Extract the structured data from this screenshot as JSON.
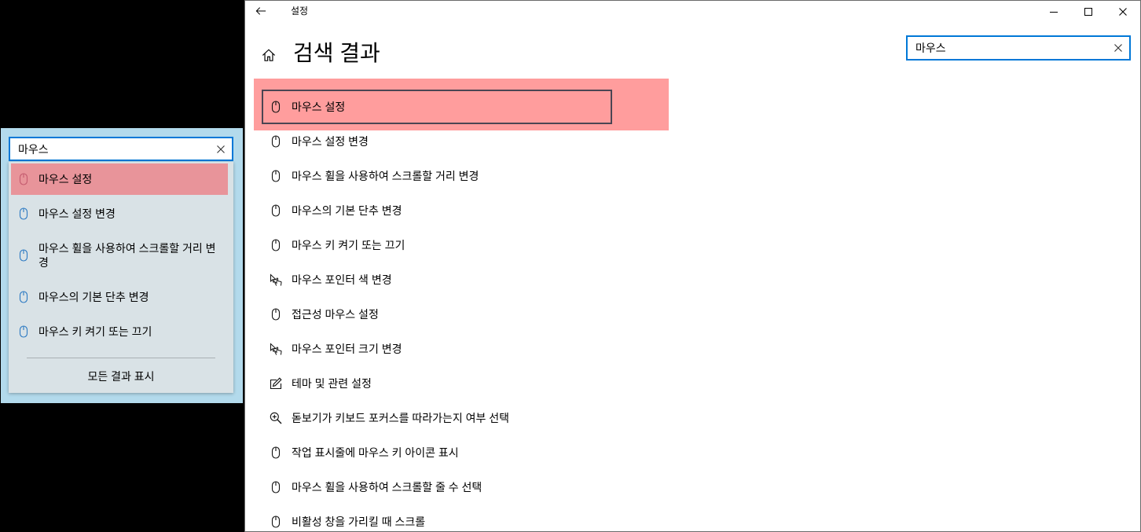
{
  "flyout": {
    "search": {
      "value": "마우스",
      "clear_icon": "clear-icon"
    },
    "results": [
      {
        "label": "마우스 설정",
        "icon": "mouse-icon",
        "highlighted": true
      },
      {
        "label": "마우스 설정 변경",
        "icon": "mouse-icon"
      },
      {
        "label": "마우스 휠을 사용하여 스크롤할 거리 변경",
        "icon": "mouse-icon"
      },
      {
        "label": "마우스의 기본 단추 변경",
        "icon": "mouse-icon"
      },
      {
        "label": "마우스 키 켜기 또는 끄기",
        "icon": "mouse-icon"
      }
    ],
    "show_all_label": "모든 결과 표시"
  },
  "window": {
    "title": "설정",
    "back_icon": "back-arrow-icon",
    "controls": {
      "minimize_icon": "minimize-icon",
      "maximize_icon": "maximize-icon",
      "close_icon": "close-icon"
    },
    "home_icon": "home-icon",
    "page_title": "검색 결과",
    "search": {
      "value": "마우스",
      "clear_icon": "clear-icon"
    },
    "results": [
      {
        "label": "마우스 설정",
        "icon": "mouse-icon",
        "focused": true,
        "highlighted": true
      },
      {
        "label": "마우스 설정 변경",
        "icon": "mouse-icon"
      },
      {
        "label": "마우스 휠을 사용하여 스크롤할 거리 변경",
        "icon": "mouse-icon"
      },
      {
        "label": "마우스의 기본 단추 변경",
        "icon": "mouse-icon"
      },
      {
        "label": "마우스 키 켜기 또는 끄기",
        "icon": "mouse-icon"
      },
      {
        "label": "마우스 포인터 색 변경",
        "icon": "mouse-pointer-icon"
      },
      {
        "label": "접근성 마우스 설정",
        "icon": "mouse-icon"
      },
      {
        "label": "마우스 포인터 크기 변경",
        "icon": "mouse-pointer-icon"
      },
      {
        "label": "테마 및 관련 설정",
        "icon": "personalization-icon"
      },
      {
        "label": "돋보기가 키보드 포커스를 따라가는지 여부 선택",
        "icon": "magnifier-icon"
      },
      {
        "label": "작업 표시줄에 마우스 키 아이콘 표시",
        "icon": "mouse-icon"
      },
      {
        "label": "마우스 휠을 사용하여 스크롤할 줄 수 선택",
        "icon": "mouse-icon"
      },
      {
        "label": "비활성 창을 가리킬 때 스크롤",
        "icon": "mouse-icon"
      }
    ]
  },
  "colors": {
    "accent": "#0078d7",
    "highlight": "#ff9d9d",
    "flyout_highlight": "#e8949a",
    "flyout_icon": "#2b79c2",
    "flyout_backdrop": "#b3daec",
    "flyout_panel": "#d9e2e6",
    "focus_border": "#4b4553"
  }
}
